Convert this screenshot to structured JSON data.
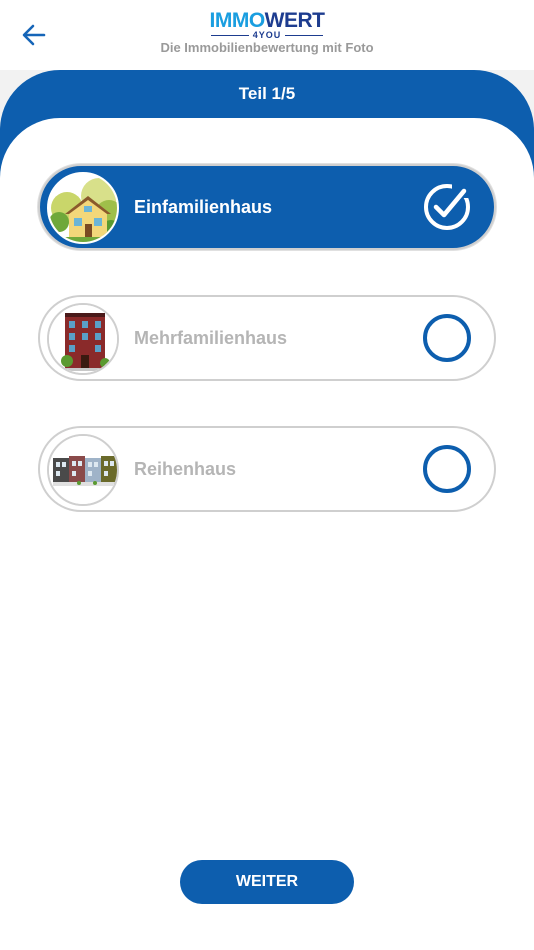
{
  "header": {
    "logo_part1": "IMMO",
    "logo_part2": "WERT",
    "logo_sub": "4YOU",
    "tagline": "Die Immobilienbewertung mit Foto"
  },
  "banner": {
    "title": "Teil 1/5"
  },
  "options": [
    {
      "label": "Einfamilienhaus",
      "selected": true,
      "icon": "single-family-house-icon"
    },
    {
      "label": "Mehrfamilienhaus",
      "selected": false,
      "icon": "apartment-building-icon"
    },
    {
      "label": "Reihenhaus",
      "selected": false,
      "icon": "terraced-houses-icon"
    }
  ],
  "footer": {
    "button_label": "WEITER"
  },
  "colors": {
    "primary": "#0d5eae",
    "logo_light": "#1a9ee0",
    "logo_dark": "#1d3c8f",
    "muted_text": "#b5b5b5"
  }
}
